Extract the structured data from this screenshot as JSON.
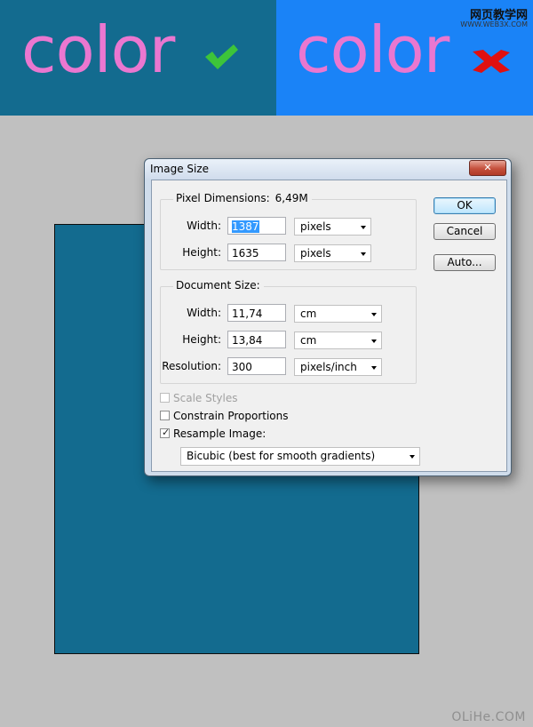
{
  "banner": {
    "left_word": "color",
    "right_word": "color",
    "site_name": "网页教学网",
    "site_url": "WWW.WEB3X.COM",
    "colors": {
      "left_bg": "#136b8f",
      "right_bg": "#1a83f7",
      "text": "#ea77d0",
      "check": "#3dc43a",
      "cross": "#e01010"
    }
  },
  "dialog": {
    "title": "Image Size",
    "close_icon": "close-icon",
    "pixel_dimensions": {
      "legend": "Pixel Dimensions:",
      "size": "6,49M",
      "width_label": "Width:",
      "width_value": "1387",
      "width_unit": "pixels",
      "height_label": "Height:",
      "height_value": "1635",
      "height_unit": "pixels"
    },
    "document_size": {
      "legend": "Document Size:",
      "width_label": "Width:",
      "width_value": "11,74",
      "width_unit": "cm",
      "height_label": "Height:",
      "height_value": "13,84",
      "height_unit": "cm",
      "resolution_label": "Resolution:",
      "resolution_value": "300",
      "resolution_unit": "pixels/inch"
    },
    "checkboxes": {
      "scale_styles": "Scale Styles",
      "constrain_proportions": "Constrain Proportions",
      "resample_image": "Resample Image:"
    },
    "resample_method": "Bicubic (best for smooth gradients)",
    "buttons": {
      "ok": "OK",
      "cancel": "Cancel",
      "auto": "Auto..."
    }
  },
  "watermark": "OLiHe.COM"
}
